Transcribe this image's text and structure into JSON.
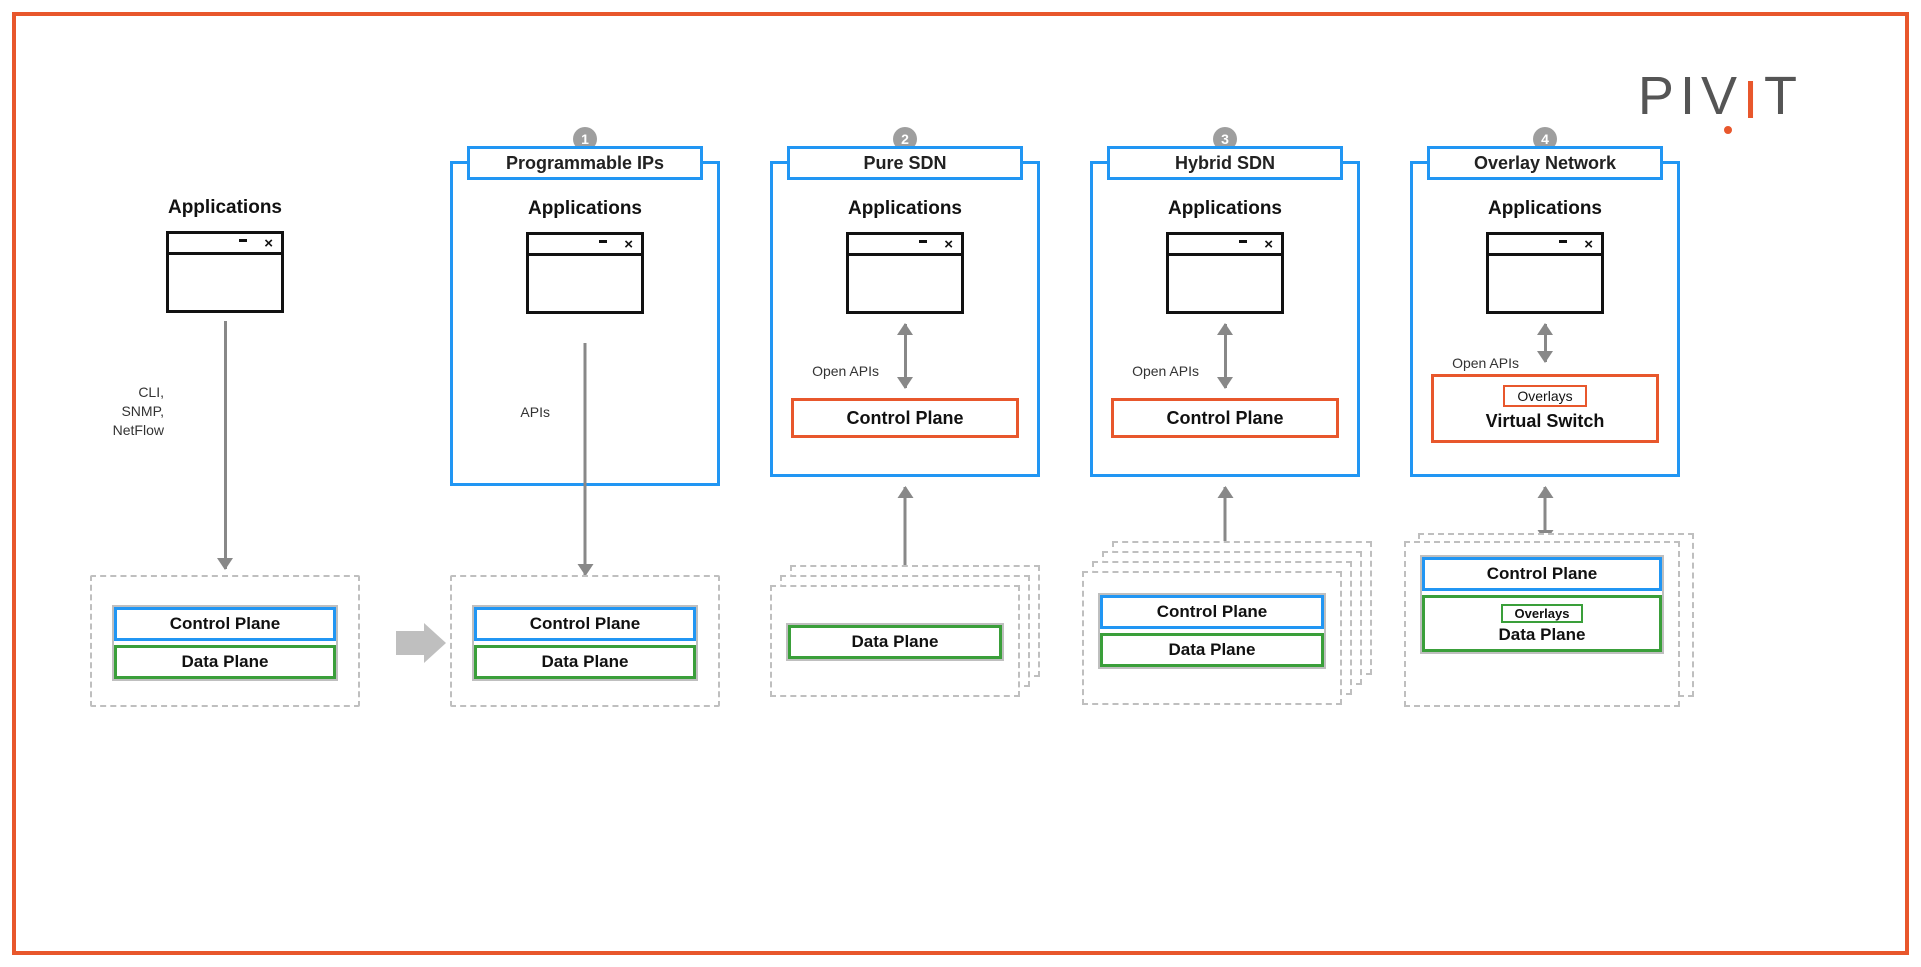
{
  "logo": {
    "p": "P",
    "i": "I",
    "v": "V",
    "i2": "I",
    "t": "T"
  },
  "legacy": {
    "apps": "Applications",
    "side_label": "CLI,\nSNMP,\nNetFlow",
    "control": "Control Plane",
    "data": "Data Plane"
  },
  "cols": [
    {
      "num": "1",
      "tab": "Programmable IPs",
      "apps": "Applications",
      "side": "APIs",
      "control": "Control Plane",
      "data": "Data Plane"
    },
    {
      "num": "2",
      "tab": "Pure SDN",
      "apps": "Applications",
      "side": "Open APIs",
      "ctrl_orange": "Control Plane",
      "data": "Data Plane"
    },
    {
      "num": "3",
      "tab": "Hybrid SDN",
      "apps": "Applications",
      "side": "Open APIs",
      "ctrl_orange": "Control Plane",
      "control": "Control Plane",
      "data": "Data Plane"
    },
    {
      "num": "4",
      "tab": "Overlay Network",
      "apps": "Applications",
      "side": "Open APIs",
      "ov_label_top": "Overlays",
      "vswitch": "Virtual Switch",
      "control": "Control Plane",
      "ov_label_bot": "Overlays",
      "data": "Data Plane"
    }
  ]
}
